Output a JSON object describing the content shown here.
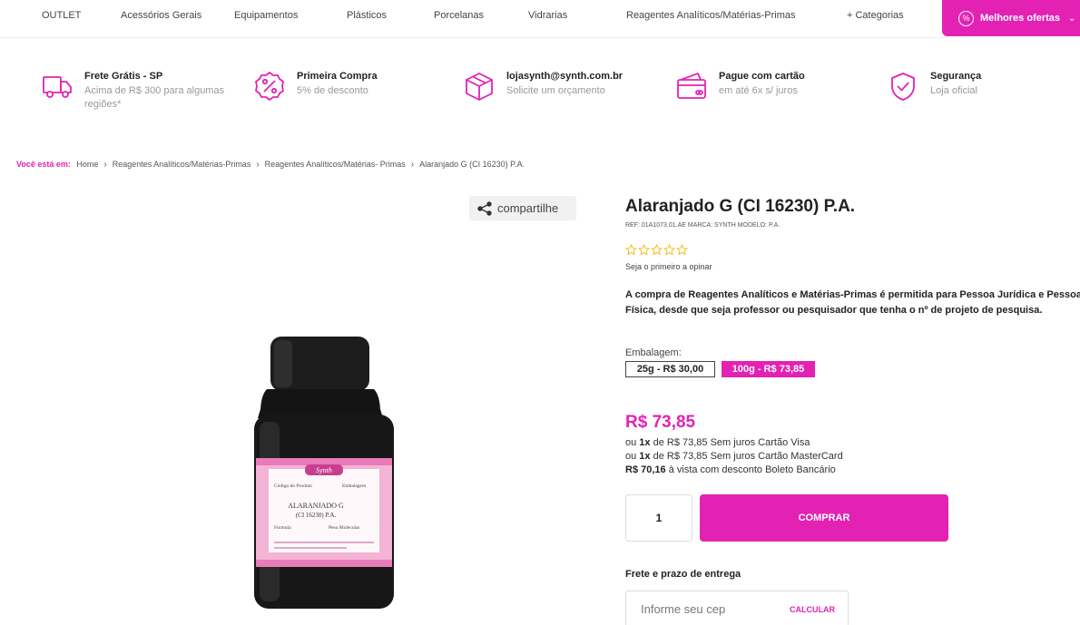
{
  "nav": {
    "categories": [
      "OUTLET",
      "Acessórios Gerais",
      "Equipamentos",
      "Plásticos",
      "Porcelanas",
      "Vidrarias",
      "Reagentes Analíticos/Matérias-Primas",
      "+ Categorias"
    ],
    "promo_label": "Melhores ofertas"
  },
  "benefits": [
    {
      "title": "Frete Grátis - SP",
      "subtitle": "Acima de R$ 300 para algumas regiões*",
      "icon": "truck-icon"
    },
    {
      "title": "Primeira Compra",
      "subtitle": "5% de desconto",
      "icon": "percent-badge-icon"
    },
    {
      "title": "lojasynth@synth.com.br",
      "subtitle": "Solicite um orçamento",
      "icon": "box-icon"
    },
    {
      "title": "Pague com cartão",
      "subtitle": "em até 6x s/ juros",
      "icon": "credit-card-icon"
    },
    {
      "title": "Segurança",
      "subtitle": "Loja oficial",
      "icon": "shield-check-icon"
    }
  ],
  "breadcrumb": {
    "lead": "Você está em:",
    "items": [
      "Home",
      "Reagentes Analíticos/Matérias-Primas",
      "Reagentes Analíticos/Matérias- Primas",
      "Alaranjado G (CI 16230) P.A."
    ]
  },
  "share_label": "compartilhe",
  "bottle_label": {
    "brand": "Synth",
    "code_label": "Código do Produto",
    "pack_label": "Embalagem",
    "name_line1": "ALARANJADO G",
    "name_line2": "(CI 16230) P.A.",
    "formula_label": "Fórmula",
    "weight_label": "Peso Molecular"
  },
  "product": {
    "title": "Alaranjado G (CI 16230) P.A.",
    "meta": "REF: 01A1073.01.AE   MARCA: SYNTH  MODELO: P.A.",
    "rating": 0,
    "first_review": "Seja o primeiro a opinar",
    "notice": "A compra de Reagentes Analíticos e Matérias-Primas é permitida para Pessoa Jurídica e Pessoa Física, desde que seja professor ou pesquisador que tenha o nº de projeto de pesquisa.",
    "pack_label": "Embalagem:",
    "pack_options": [
      "25g - R$ 30,00",
      "100g - R$ 73,85"
    ],
    "price": "R$ 73,85",
    "installments": [
      {
        "prefix": "ou ",
        "count": "1x",
        "rest": " de R$ 73,85 Sem juros Cartão Visa"
      },
      {
        "prefix": "ou ",
        "count": "1x",
        "rest": " de R$ 73,85 Sem juros Cartão MasterCard"
      },
      {
        "prefix": "",
        "count": "R$ 70,16",
        "rest": " à vista com desconto Boleto Bancário"
      }
    ],
    "quantity": "1",
    "buy_label": "COMPRAR",
    "shipping_title": "Frete e prazo de entrega",
    "cep_placeholder": "Informe seu cep",
    "calc_label": "CALCULAR"
  },
  "colors": {
    "accent": "#e322b4",
    "bottle_body": "#1a1a1a",
    "bottle_label": "#f4b4d6"
  }
}
